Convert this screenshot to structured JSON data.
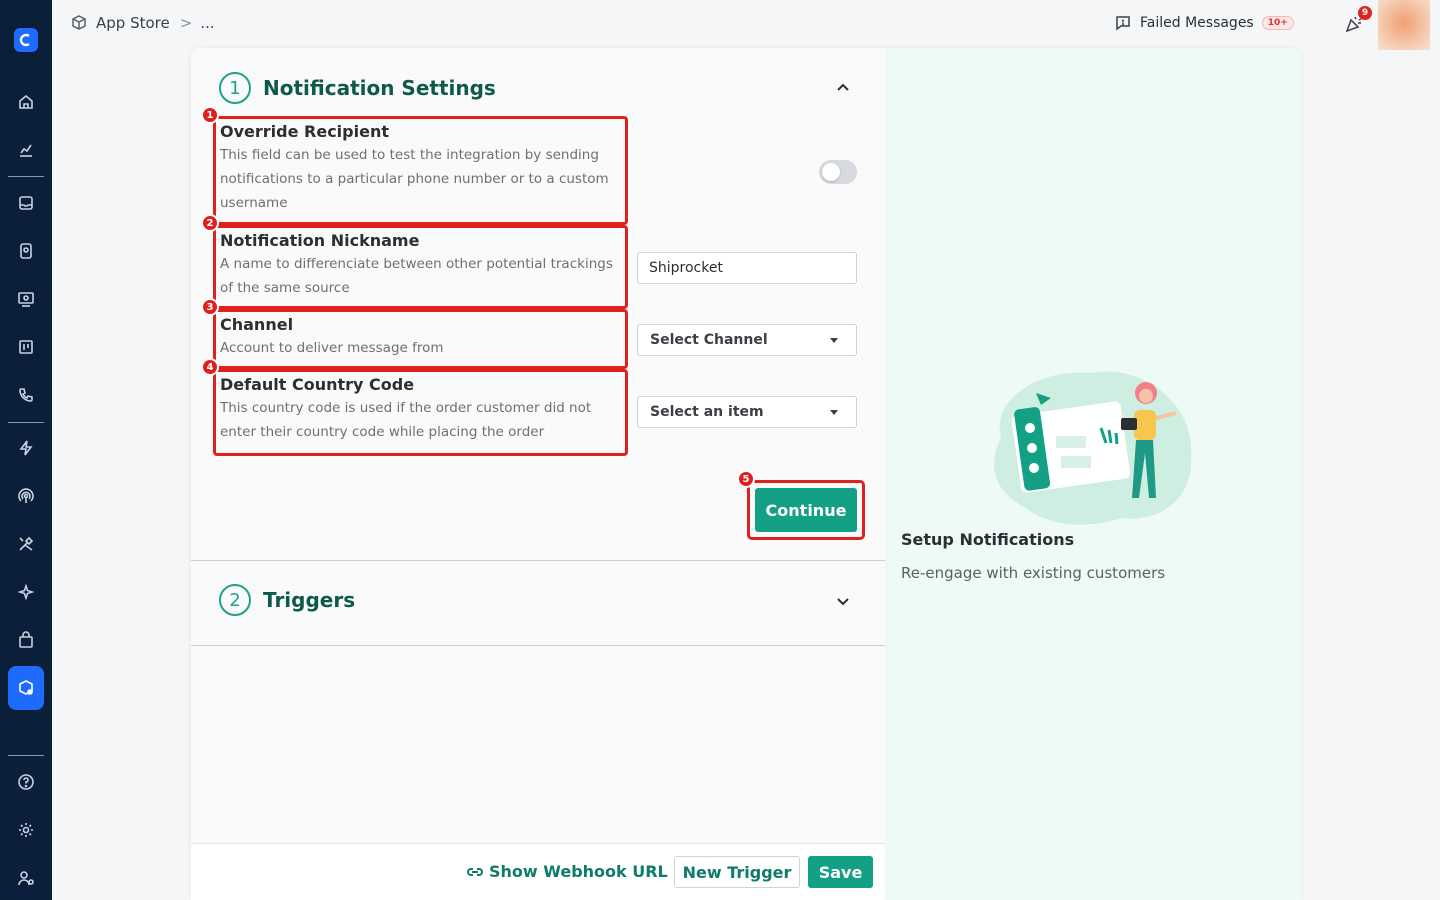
{
  "topbar": {
    "breadcrumb_root": "App Store",
    "breadcrumb_sep": ">",
    "breadcrumb_current": "...",
    "failed_messages_label": "Failed Messages",
    "failed_messages_count": "10+",
    "notifications_count": "9"
  },
  "sidebar": {
    "items": [
      "home-icon",
      "analytics-icon",
      "inbox-icon",
      "contacts-icon",
      "campaigns-icon",
      "board-icon",
      "phone-icon",
      "automation-icon",
      "broadcast-icon",
      "tools-icon",
      "ai-icon",
      "commerce-icon",
      "app-store-icon",
      "help-icon",
      "settings-icon",
      "team-icon"
    ],
    "active": "app-store-icon"
  },
  "section1": {
    "number": "1",
    "title": "Notification Settings",
    "fields": [
      {
        "badge": "1",
        "title": "Override Recipient",
        "desc": "This field can be used to test the integration by sending notifications to a particular phone number or to a custom username"
      },
      {
        "badge": "2",
        "title": "Notification Nickname",
        "desc": "A name to differenciate between other potential trackings of the same source"
      },
      {
        "badge": "3",
        "title": "Channel",
        "desc": "Account to deliver message from"
      },
      {
        "badge": "4",
        "title": "Default Country Code",
        "desc": "This country code is used if the order customer did not enter their country code while placing the order"
      }
    ],
    "override_toggle_on": false,
    "nickname_value": "Shiprocket",
    "channel_select": "Select Channel",
    "country_select": "Select an item",
    "continue_badge": "5",
    "continue_label": "Continue"
  },
  "section2": {
    "number": "2",
    "title": "Triggers"
  },
  "footer": {
    "webhook_label": "Show Webhook URL",
    "new_trigger_label": "New Trigger",
    "save_label": "Save"
  },
  "side_panel": {
    "title": "Setup Notifications",
    "description": "Re-engage with existing customers"
  },
  "colors": {
    "accent": "#13a085",
    "sidebar_bg": "#0b1f3a",
    "highlight": "#e01f1f"
  }
}
